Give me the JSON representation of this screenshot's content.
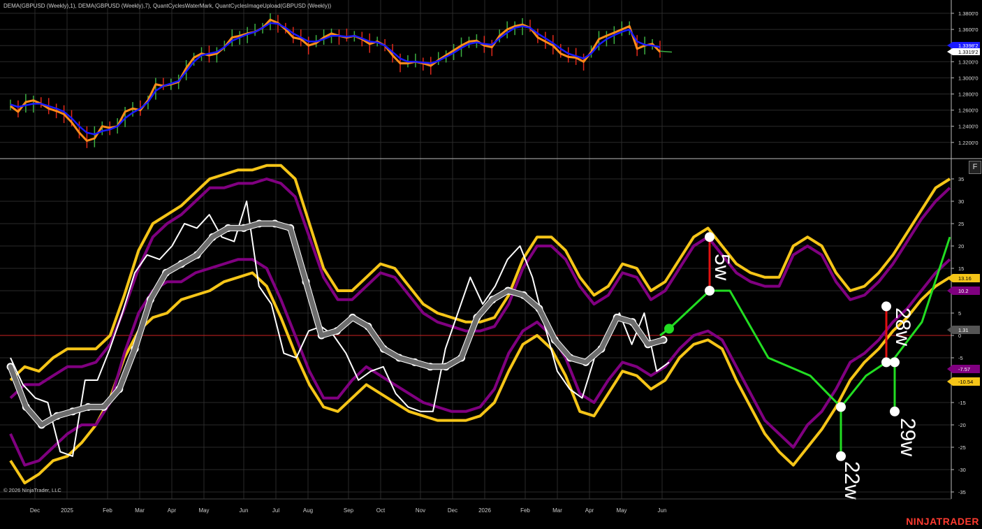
{
  "header": {
    "indicators": "DEMA(GBPUSD (Weekly),1), DEMA(GBPUSD (Weekly),7), QuantCyclesWaterMark, QuantCyclesImageUpload(GBPUSD (Weekly))"
  },
  "footer": {
    "copyright": "© 2026 NinjaTrader, LLC",
    "brand": "NINJATRADER"
  },
  "toolbar": {
    "f_button": "F"
  },
  "colors": {
    "background": "#000000",
    "grid": "#2a2a2a",
    "price_fast": "#ff8c1a",
    "price_slow": "#1a1aff",
    "bar_up": "#3cb043",
    "bar_down": "#e0281b",
    "band_outer": "#f5c518",
    "band_inner": "#800080",
    "oscillator": "#ffffff",
    "smoothed": "#6e6e6e",
    "projection": "#22dd22",
    "marker_red": "#e01010",
    "zero_line": "#cc2222"
  },
  "chart_data": [
    {
      "type": "line",
      "panel": "price",
      "yticks": [
        "1.3800'0",
        "1.3600'0",
        "1.3400'0",
        "1.3200'0",
        "1.3000'0",
        "1.2800'0",
        "1.2600'0",
        "1.2400'0",
        "1.2200'0"
      ],
      "ylim": [
        1.205,
        1.39
      ],
      "series": [
        {
          "name": "DEMA(GBPUSD (Weekly),1)",
          "values": [
            1.265,
            1.258,
            1.27,
            1.272,
            1.268,
            1.262,
            1.259,
            1.255,
            1.245,
            1.232,
            1.222,
            1.225,
            1.24,
            1.238,
            1.24,
            1.258,
            1.262,
            1.26,
            1.272,
            1.292,
            1.29,
            1.292,
            1.295,
            1.312,
            1.325,
            1.33,
            1.328,
            1.33,
            1.338,
            1.35,
            1.352,
            1.355,
            1.357,
            1.362,
            1.372,
            1.368,
            1.36,
            1.35,
            1.348,
            1.34,
            1.343,
            1.35,
            1.355,
            1.352,
            1.35,
            1.352,
            1.348,
            1.342,
            1.345,
            1.34,
            1.328,
            1.318,
            1.318,
            1.32,
            1.318,
            1.315,
            1.322,
            1.328,
            1.334,
            1.34,
            1.345,
            1.346,
            1.34,
            1.338,
            1.352,
            1.36,
            1.364,
            1.366,
            1.362,
            1.35,
            1.345,
            1.34,
            1.33,
            1.326,
            1.325,
            1.32,
            1.332,
            1.348,
            1.352,
            1.356,
            1.36,
            1.364,
            1.336,
            1.34,
            1.342,
            1.332
          ]
        },
        {
          "name": "DEMA(GBPUSD (Weekly),7)",
          "values": [
            1.267,
            1.264,
            1.266,
            1.268,
            1.268,
            1.265,
            1.262,
            1.258,
            1.25,
            1.24,
            1.232,
            1.23,
            1.234,
            1.236,
            1.24,
            1.25,
            1.257,
            1.262,
            1.27,
            1.284,
            1.29,
            1.293,
            1.296,
            1.308,
            1.32,
            1.328,
            1.33,
            1.332,
            1.338,
            1.346,
            1.35,
            1.354,
            1.357,
            1.362,
            1.368,
            1.367,
            1.362,
            1.355,
            1.35,
            1.345,
            1.345,
            1.348,
            1.352,
            1.352,
            1.351,
            1.352,
            1.349,
            1.345,
            1.344,
            1.34,
            1.332,
            1.324,
            1.32,
            1.32,
            1.319,
            1.318,
            1.321,
            1.326,
            1.331,
            1.337,
            1.342,
            1.344,
            1.342,
            1.341,
            1.349,
            1.356,
            1.362,
            1.364,
            1.362,
            1.355,
            1.349,
            1.343,
            1.336,
            1.33,
            1.327,
            1.324,
            1.33,
            1.341,
            1.348,
            1.353,
            1.357,
            1.36,
            1.345,
            1.341,
            1.34,
            1.338
          ]
        }
      ],
      "last_labels": [
        "1.3398'2",
        "1.3319'2"
      ]
    },
    {
      "type": "line",
      "panel": "cycles",
      "xticks": [
        "Dec",
        "2025",
        "Feb",
        "Mar",
        "Apr",
        "May",
        "Jun",
        "Jul",
        "Aug",
        "Sep",
        "Oct",
        "Nov",
        "Dec",
        "2026",
        "Feb",
        "Mar",
        "Apr",
        "May",
        "Jun"
      ],
      "yticks": [
        "35",
        "30",
        "25",
        "20",
        "15",
        "10",
        "5",
        "0",
        "-5",
        "-10",
        "-15",
        "-20",
        "-25",
        "-30",
        "-35"
      ],
      "ylim": [
        -37,
        39
      ],
      "series": [
        {
          "name": "upper-outer",
          "values": [
            -10,
            -7,
            -8,
            -5,
            -3,
            -3,
            -3,
            0,
            9,
            19,
            25,
            27,
            29,
            32,
            35,
            36,
            37,
            37,
            38,
            38,
            35,
            25,
            15,
            10,
            10,
            13,
            16,
            15,
            11,
            7,
            5,
            4,
            3,
            3,
            4,
            9,
            17,
            22,
            22,
            19,
            13,
            9,
            11,
            16,
            15,
            10,
            12,
            17,
            22,
            24,
            20,
            16,
            14,
            13,
            13,
            20,
            22,
            20,
            14,
            10,
            11,
            14,
            18,
            23,
            28,
            33,
            35
          ]
        },
        {
          "name": "upper-inner",
          "values": [
            -14,
            -11,
            -11,
            -9,
            -7,
            -7,
            -6,
            -2,
            6,
            15,
            22,
            25,
            27,
            30,
            33,
            33,
            34,
            34,
            35,
            34,
            31,
            22,
            13,
            8,
            8,
            11,
            14,
            13,
            9,
            5,
            3,
            2,
            1,
            1,
            2,
            7,
            15,
            20,
            20,
            17,
            11,
            7,
            9,
            14,
            13,
            8,
            10,
            15,
            20,
            22,
            18,
            14,
            12,
            11,
            11,
            18,
            20,
            18,
            12,
            8,
            9,
            12,
            16,
            21,
            26,
            30,
            33
          ]
        },
        {
          "name": "lower-inner",
          "values": [
            -22,
            -29,
            -28,
            -25,
            -22,
            -20,
            -20,
            -15,
            -4,
            5,
            10,
            12,
            12,
            14,
            15,
            16,
            17,
            17,
            15,
            8,
            0,
            -8,
            -14,
            -14,
            -10,
            -7,
            -9,
            -11,
            -13,
            -15,
            -16,
            -17,
            -17,
            -16,
            -12,
            -4,
            1,
            3,
            0,
            -5,
            -13,
            -15,
            -10,
            -6,
            -7,
            -9,
            -7,
            -3,
            0,
            1,
            -1,
            -7,
            -13,
            -19,
            -22,
            -25,
            -20,
            -17,
            -12,
            -6,
            -4,
            -1,
            3,
            6,
            10,
            14,
            17
          ]
        },
        {
          "name": "lower-outer",
          "values": [
            -28,
            -33,
            -31,
            -28,
            -27,
            -24,
            -20,
            -14,
            -5,
            1,
            4,
            5,
            8,
            9,
            10,
            12,
            13,
            14,
            11,
            4,
            -4,
            -11,
            -16,
            -17,
            -14,
            -11,
            -13,
            -15,
            -17,
            -18,
            -19,
            -19,
            -19,
            -18,
            -15,
            -8,
            -2,
            0,
            -3,
            -9,
            -17,
            -18,
            -13,
            -8,
            -9,
            -12,
            -10,
            -5,
            -2,
            -1,
            -3,
            -10,
            -16,
            -22,
            -26,
            -29,
            -25,
            -21,
            -16,
            -10,
            -6,
            -3,
            1,
            4,
            8,
            11,
            13
          ]
        },
        {
          "name": "oscillator",
          "values": [
            -5,
            -11,
            -14,
            -15,
            -26,
            -27,
            -10,
            -10,
            -3,
            5,
            14,
            18,
            17,
            20,
            25,
            24,
            27,
            22,
            21,
            30,
            11,
            7,
            -4,
            -5,
            1,
            2,
            0,
            -4,
            -10,
            -8,
            -7,
            -13,
            -16,
            -17,
            -17,
            -3,
            5,
            13,
            7,
            11,
            17,
            20,
            13,
            2,
            -8,
            -12,
            -14,
            -5,
            -1,
            5,
            -2,
            5,
            -8,
            -6
          ]
        },
        {
          "name": "smoothed",
          "values": [
            -7,
            -16,
            -20,
            -18,
            -17,
            -16,
            -16,
            -12,
            -3,
            8,
            14,
            16,
            18,
            22,
            24,
            24,
            25,
            25,
            24,
            12,
            0,
            1,
            4,
            2,
            -3,
            -5,
            -6,
            -7,
            -7,
            -5,
            4,
            8,
            10,
            9,
            6,
            -1,
            -5,
            -6,
            -3,
            4,
            3,
            -2,
            -1
          ]
        },
        {
          "name": "projection",
          "values": [
            0,
            2,
            10,
            10,
            -9,
            -16,
            -27,
            -6,
            -6,
            -17,
            13,
            22
          ]
        }
      ],
      "cycle_labels": [
        "5w",
        "22w",
        "28w",
        "29w"
      ],
      "right_labels": [
        "13.16",
        "10.2",
        "1.31",
        "-7.57",
        "-10.54"
      ]
    }
  ]
}
